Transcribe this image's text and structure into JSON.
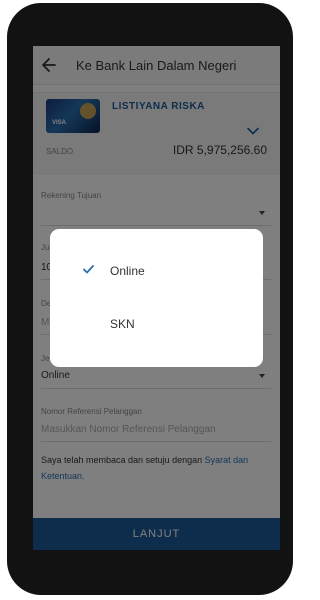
{
  "header": {
    "title": "Ke Bank Lain Dalam Negeri"
  },
  "account": {
    "holder_name": "LISTIYANA RISKA",
    "card_brand": "VISA",
    "balance_label": "SALDO",
    "balance_value": "IDR 5,975,256.60"
  },
  "form": {
    "rekening_label": "Rekening Tujuan",
    "jumlah_label": "Ju",
    "jumlah_value": "10",
    "deskripsi_label": "De",
    "deskripsi_value": "M",
    "jenis_label": "Je",
    "jenis_value": "Online",
    "referensi_label": "Nomor Referensi Pelanggan",
    "referensi_placeholder": "Masukkan Nomor Referensi Pelanggan"
  },
  "terms": {
    "text": "Saya telah membaca dan setuju dengan ",
    "link_part1": "Syarat dan",
    "link_part2": "Ketentuan."
  },
  "submit_label": "LANJUT",
  "dialog": {
    "options": [
      {
        "label": "Online",
        "selected": true
      },
      {
        "label": "SKN",
        "selected": false
      }
    ]
  },
  "colors": {
    "primary": "#1d5a9b",
    "link": "#2a6fb0"
  }
}
